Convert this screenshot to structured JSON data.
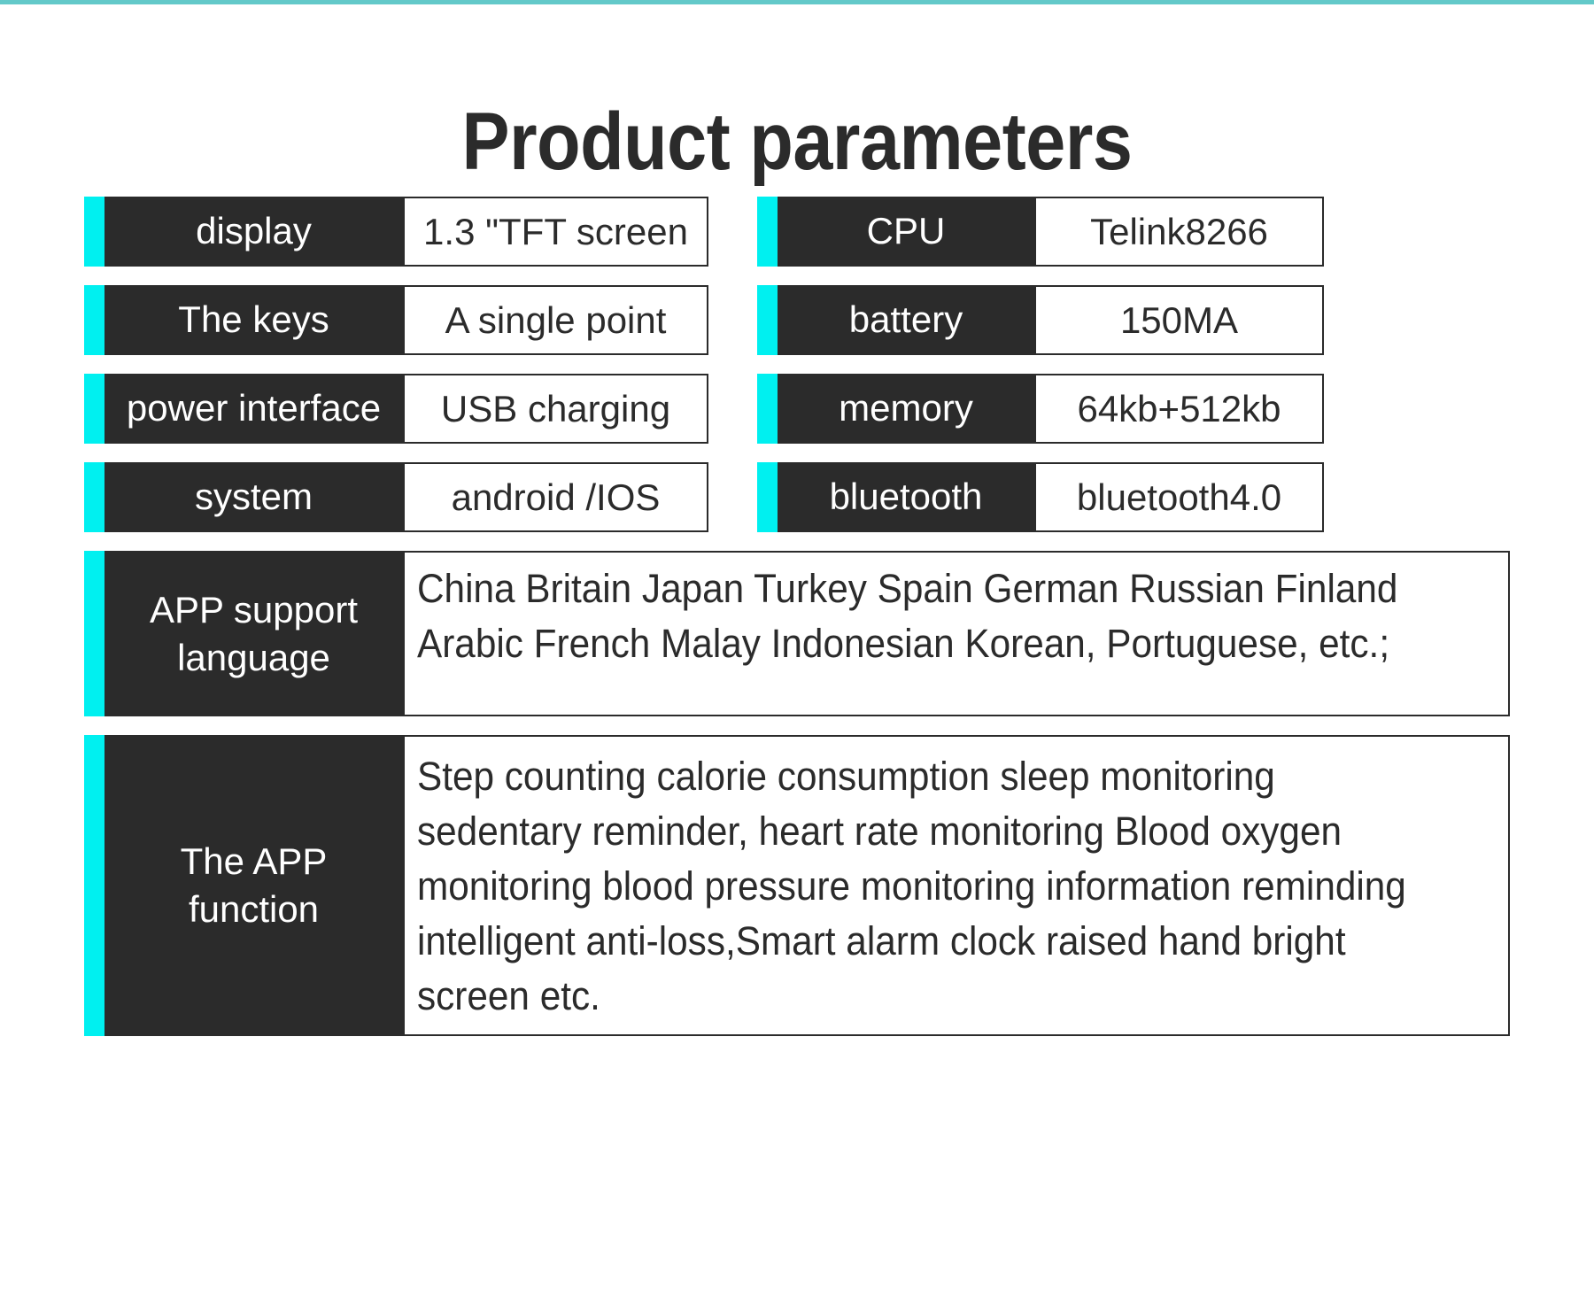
{
  "theme": {
    "accent_cyan": "#00f0f0",
    "top_rule_teal": "#63c9c9",
    "dark": "#2b2b2b",
    "white": "#ffffff"
  },
  "page": {
    "title": "Product parameters"
  },
  "spec_rows": [
    {
      "left": {
        "label": "display",
        "value": "1.3 \"TFT screen"
      },
      "right": {
        "label": "CPU",
        "value": "Telink8266"
      }
    },
    {
      "left": {
        "label": "The keys",
        "value": "A single point"
      },
      "right": {
        "label": "battery",
        "value": "150MA"
      }
    },
    {
      "left": {
        "label": "power interface",
        "value": "USB charging"
      },
      "right": {
        "label": "memory",
        "value": "64kb+512kb"
      }
    },
    {
      "left": {
        "label": "system",
        "value": "android /IOS"
      },
      "right": {
        "label": "bluetooth",
        "value": "bluetooth4.0"
      }
    }
  ],
  "wide_rows": [
    {
      "label": "APP support language",
      "value": "China Britain Japan Turkey Spain German Russian Finland Arabic French Malay Indonesian Korean, Portuguese, etc.;"
    },
    {
      "label": "The APP function",
      "value": "Step counting calorie consumption sleep monitoring sedentary reminder, heart rate monitoring Blood oxygen monitoring blood pressure monitoring information reminding intelligent anti-loss,Smart alarm clock raised hand bright screen etc."
    }
  ]
}
